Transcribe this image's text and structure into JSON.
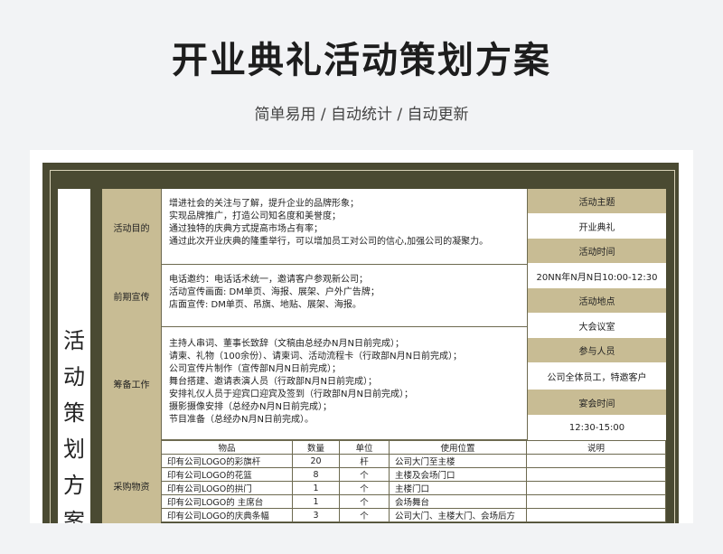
{
  "header": {
    "title": "开业典礼活动策划方案",
    "subtitle": "简单易用 / 自动统计 / 自动更新"
  },
  "sheet": {
    "vertical_title": "活动策划方案",
    "sections": [
      {
        "label": "活动目的",
        "lines": [
          "增进社会的关注与了解，提升企业的品牌形象；",
          "实现品牌推广，打造公司知名度和美誉度；",
          "通过独特的庆典方式提高市场占有率；",
          "通过此次开业庆典的隆重举行，可以增加员工对公司的信心,加强公司的凝聚力。"
        ]
      },
      {
        "label": "前期宣传",
        "lines": [
          "电话邀约：电话话术统一，邀请客户参观新公司；",
          "活动宣传画面: DM单页、海报、展架、户外广告牌；",
          "店面宣传: DM单页、吊旗、地贴、展架、海报。"
        ]
      },
      {
        "label": "筹备工作",
        "lines": [
          "主持人串词、董事长致辞（文稿由总经办N月N日前完成）；",
          "请柬、礼物（100余份）、请柬词、活动流程卡（行政部N月N日前完成）；",
          "公司宣传片制作（宣传部N月N日前完成）；",
          "舞台搭建、邀请表演人员（行政部N月N日前完成）；",
          "安排礼仪人员于迎宾口迎宾及签到（行政部N月N日前完成）；",
          "摄影摄像安排（总经办N月N日前完成）；",
          "节目准备（总经办N月N日前完成）。"
        ]
      },
      {
        "label": "采购物资"
      }
    ],
    "side": [
      {
        "label": "活动主题",
        "value": "开业典礼"
      },
      {
        "label": "活动时间",
        "value": "20NN年N月N日10:00-12:30"
      },
      {
        "label": "活动地点",
        "value": "大会议室"
      },
      {
        "label": "参与人员",
        "value": "公司全体员工，特邀客户"
      },
      {
        "label": "宴会时间",
        "value": "12:30-15:00"
      }
    ],
    "purchase": {
      "headers": [
        "物品",
        "数量",
        "单位",
        "使用位置",
        "说明"
      ],
      "rows": [
        [
          "印有公司LOGO的彩旗杆",
          "20",
          "杆",
          "公司大门至主楼",
          ""
        ],
        [
          "印有公司LOGO的花篮",
          "8",
          "个",
          "主楼及会场门口",
          ""
        ],
        [
          "印有公司LOGO的拱门",
          "1",
          "个",
          "主楼门口",
          ""
        ],
        [
          "印有公司LOGO的 主席台",
          "1",
          "个",
          "会场舞台",
          ""
        ],
        [
          "印有公司LOGO的庆典条幅",
          "3",
          "个",
          "公司大门、主楼大门、会场后方",
          ""
        ]
      ]
    }
  }
}
